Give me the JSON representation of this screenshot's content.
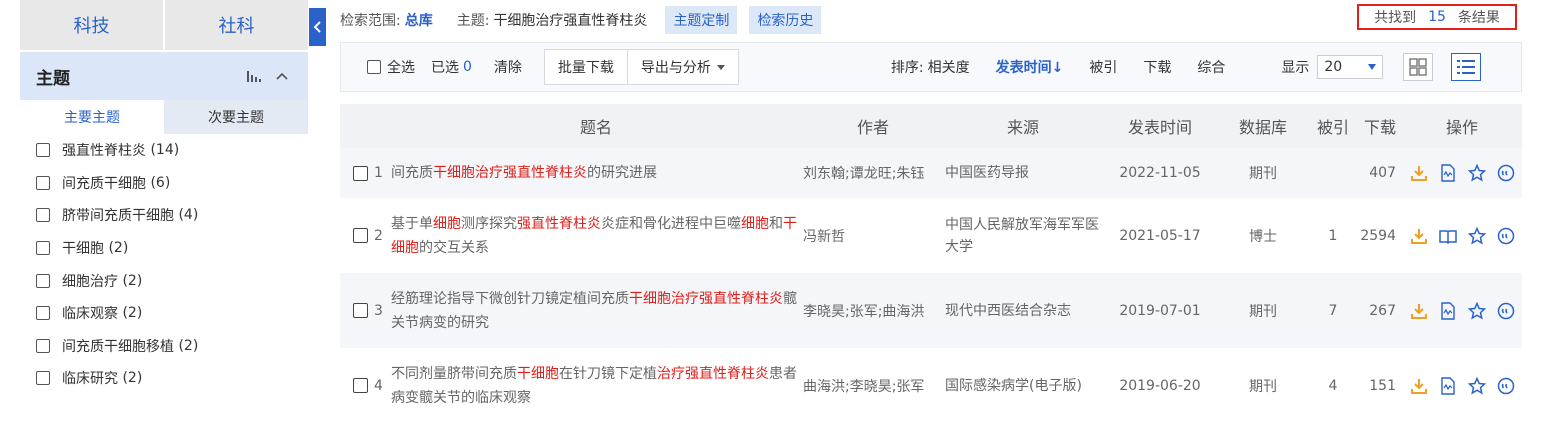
{
  "sidebar": {
    "disciplines": [
      "科技",
      "社科"
    ],
    "facet_title": "主题",
    "subtabs": [
      "主要主题",
      "次要主题"
    ],
    "items": [
      {
        "label": "强直性脊柱炎",
        "count": "(14)"
      },
      {
        "label": "间充质干细胞",
        "count": "(6)"
      },
      {
        "label": "脐带间充质干细胞",
        "count": "(4)"
      },
      {
        "label": "干细胞",
        "count": "(2)"
      },
      {
        "label": "细胞治疗",
        "count": "(2)"
      },
      {
        "label": "临床观察",
        "count": "(2)"
      },
      {
        "label": "间充质干细胞移植",
        "count": "(2)"
      },
      {
        "label": "临床研究",
        "count": "(2)"
      }
    ]
  },
  "scope": {
    "scope_label": "检索范围:",
    "scope_value": "总库",
    "topic_label": "主题:",
    "topic_value": "干细胞治疗强直性脊柱炎",
    "custom_button": "主题定制",
    "history_button": "检索历史"
  },
  "result_count": {
    "prefix": "共找到",
    "count": "15",
    "suffix": "条结果"
  },
  "toolbar": {
    "select_all": "全选",
    "selected_label": "已选",
    "selected_count": "0",
    "clear": "清除",
    "batch_download": "批量下载",
    "export_analyze": "导出与分析",
    "sort_label": "排序:",
    "sort_options": [
      "相关度",
      "发表时间↓",
      "被引",
      "下载",
      "综合"
    ],
    "display_label": "显示",
    "page_size": "20"
  },
  "table": {
    "headers": [
      "题名",
      "作者",
      "来源",
      "发表时间",
      "数据库",
      "被引",
      "下载",
      "操作"
    ],
    "rows": [
      {
        "index": "1",
        "title_parts": [
          {
            "text": "间充质",
            "hl": false
          },
          {
            "text": "干细胞治疗强直性脊柱炎",
            "hl": true
          },
          {
            "text": "的研究进展",
            "hl": false
          }
        ],
        "authors": "刘东翰;谭龙旺;朱钰",
        "source": "中国医药导报",
        "date": "2022-11-05",
        "db": "期刊",
        "cited": "",
        "downloads": "407"
      },
      {
        "index": "2",
        "title_parts": [
          {
            "text": "基于单",
            "hl": false
          },
          {
            "text": "细胞",
            "hl": true
          },
          {
            "text": "测序探究",
            "hl": false
          },
          {
            "text": "强直性脊柱炎",
            "hl": true
          },
          {
            "text": "炎症和骨化进程中巨噬",
            "hl": false
          },
          {
            "text": "细胞",
            "hl": true
          },
          {
            "text": "和",
            "hl": false
          },
          {
            "text": "干细胞",
            "hl": true
          },
          {
            "text": "的交互关系",
            "hl": false
          }
        ],
        "authors": "冯新哲",
        "source": "中国人民解放军海军军医大学",
        "date": "2021-05-17",
        "db": "博士",
        "cited": "1",
        "downloads": "2594"
      },
      {
        "index": "3",
        "title_parts": [
          {
            "text": "经筋理论指导下微创针刀镜定植间充质",
            "hl": false
          },
          {
            "text": "干细胞治疗强直性脊柱炎",
            "hl": true
          },
          {
            "text": "髋关节病变的研究",
            "hl": false
          }
        ],
        "authors": "李晓昊;张军;曲海洪",
        "source": "现代中西医结合杂志",
        "date": "2019-07-01",
        "db": "期刊",
        "cited": "7",
        "downloads": "267"
      },
      {
        "index": "4",
        "title_parts": [
          {
            "text": "不同剂量脐带间充质",
            "hl": false
          },
          {
            "text": "干细胞",
            "hl": true
          },
          {
            "text": "在针刀镜下定植",
            "hl": false
          },
          {
            "text": "治疗强直性脊柱炎",
            "hl": true
          },
          {
            "text": "患者病变髋关节的临床观察",
            "hl": false
          }
        ],
        "authors": "曲海洪;李晓昊;张军",
        "source": "国际感染病学(电子版)",
        "date": "2019-06-20",
        "db": "期刊",
        "cited": "4",
        "downloads": "151"
      }
    ]
  },
  "icons": {
    "download": "download-icon",
    "html": "html-reader-icon",
    "read": "book-read-icon",
    "favorite": "star-icon",
    "cite": "quote-icon"
  },
  "colors": {
    "accent": "#2a62c9",
    "highlight": "#e0201b",
    "download_orange": "#f0a020",
    "frame_red": "#e0201b"
  }
}
